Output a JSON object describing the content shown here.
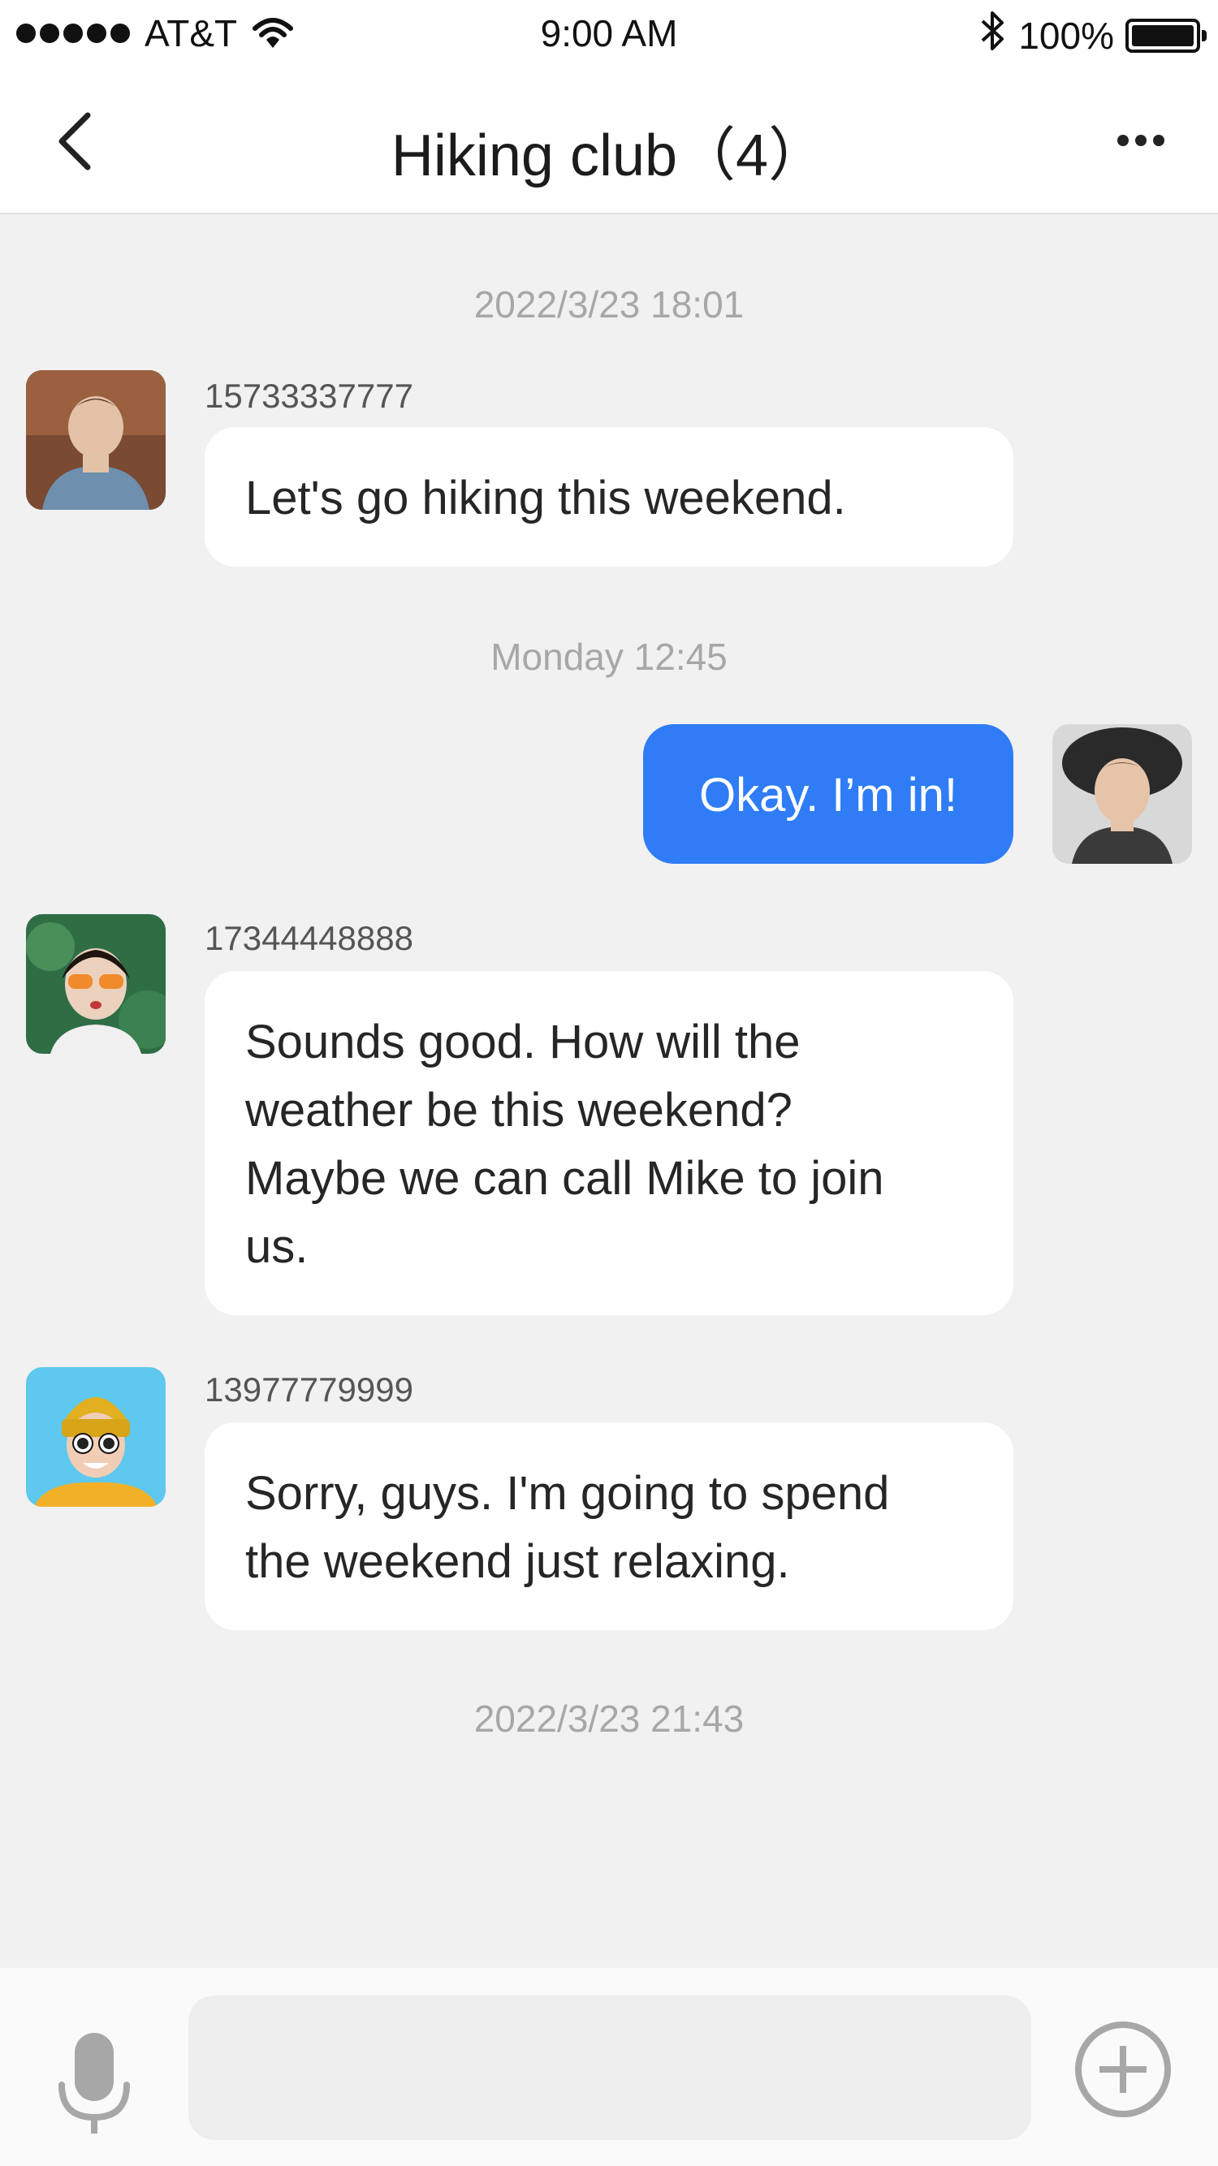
{
  "status_bar": {
    "carrier": "AT&T",
    "time": "9:00 AM",
    "bluetooth_icon": "bluetooth-icon",
    "battery": "100%",
    "battery_level": 1.0
  },
  "nav": {
    "back_icon": "chevron-left-icon",
    "title": "Hiking club（4）",
    "more_icon": "more-horizontal-icon"
  },
  "messages": {
    "timestamps": [
      "2022/3/23  18:01",
      "Monday 12:45",
      "2022/3/23 21:43"
    ],
    "items": [
      {
        "sender": "15733337777",
        "text": "Let's go hiking this weekend.",
        "mine": false
      },
      {
        "sender": "",
        "text": "Okay. I’m in!",
        "mine": true
      },
      {
        "sender": "17344448888",
        "text": "Sounds good. How will the\nweather be this weekend?\nMaybe we can call Mike to join\nus.",
        "mine": false
      },
      {
        "sender": "13977779999",
        "text": "Sorry, guys. I'm going to spend\nthe weekend just relaxing.",
        "mine": false
      }
    ]
  },
  "input_bar": {
    "mic_icon": "microphone-icon",
    "input_value": "",
    "input_placeholder": "",
    "plus_icon": "plus-circle-icon"
  },
  "colors": {
    "accent": "#2f7cf6",
    "background": "#f1f1f1",
    "bubble": "#ffffff",
    "timestamp_text": "#a7a7a7"
  }
}
